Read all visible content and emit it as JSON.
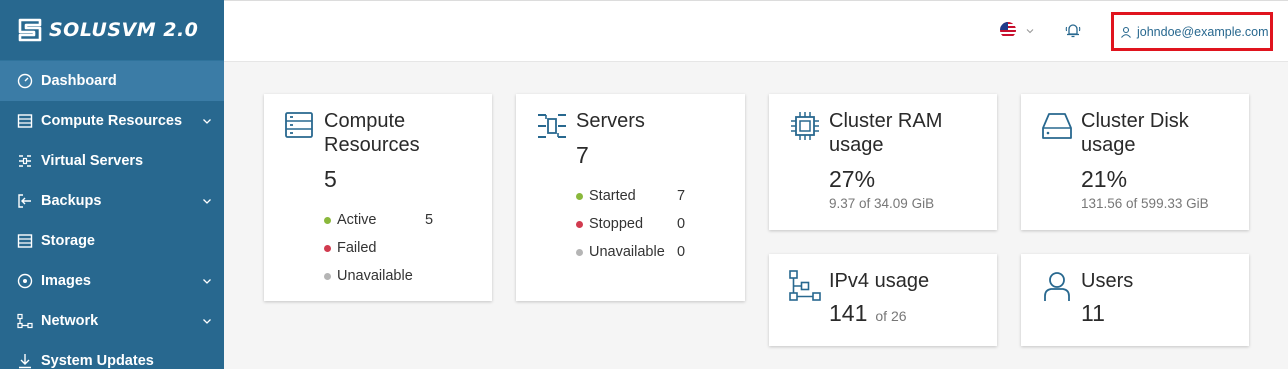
{
  "app": {
    "logo_text": "SOLUSVM 2.0"
  },
  "sidebar": {
    "items": [
      {
        "label": "Dashboard",
        "icon": "dashboard-icon",
        "active": true,
        "has_children": false
      },
      {
        "label": "Compute Resources",
        "icon": "compute-resources-icon",
        "active": false,
        "has_children": true
      },
      {
        "label": "Virtual Servers",
        "icon": "virtual-servers-icon",
        "active": false,
        "has_children": false
      },
      {
        "label": "Backups",
        "icon": "backups-icon",
        "active": false,
        "has_children": true
      },
      {
        "label": "Storage",
        "icon": "storage-icon",
        "active": false,
        "has_children": false
      },
      {
        "label": "Images",
        "icon": "images-icon",
        "active": false,
        "has_children": true
      },
      {
        "label": "Network",
        "icon": "network-icon",
        "active": false,
        "has_children": true
      },
      {
        "label": "System Updates",
        "icon": "system-updates-icon",
        "active": false,
        "has_children": false
      }
    ]
  },
  "topbar": {
    "language_icon": "us-flag-icon",
    "notifications_icon": "bell-icon",
    "user_email": "johndoe@example.com"
  },
  "cards": {
    "compute": {
      "title": "Compute Resources",
      "value": "5",
      "stats": [
        {
          "label": "Active",
          "count": "5",
          "color": "#8ab83c"
        },
        {
          "label": "Failed",
          "count": "",
          "color": "#d13b4f"
        },
        {
          "label": "Unavailable",
          "count": "",
          "color": "#b5b5b5"
        }
      ]
    },
    "servers": {
      "title": "Servers",
      "value": "7",
      "stats": [
        {
          "label": "Started",
          "count": "7",
          "color": "#8ab83c"
        },
        {
          "label": "Stopped",
          "count": "0",
          "color": "#d13b4f"
        },
        {
          "label": "Unavailable",
          "count": "0",
          "color": "#b5b5b5"
        }
      ]
    },
    "ram": {
      "title": "Cluster RAM usage",
      "value": "27%",
      "sub": "9.37 of 34.09 GiB"
    },
    "disk": {
      "title": "Cluster Disk usage",
      "value": "21%",
      "sub": "131.56 of 599.33 GiB"
    },
    "ipv4": {
      "title": "IPv4 usage",
      "value": "141",
      "sub": "of 26"
    },
    "users": {
      "title": "Users",
      "value": "11"
    }
  },
  "colors": {
    "sidebar_bg": "#28688f",
    "accent": "#28688f",
    "highlight_border": "#e0141e"
  }
}
